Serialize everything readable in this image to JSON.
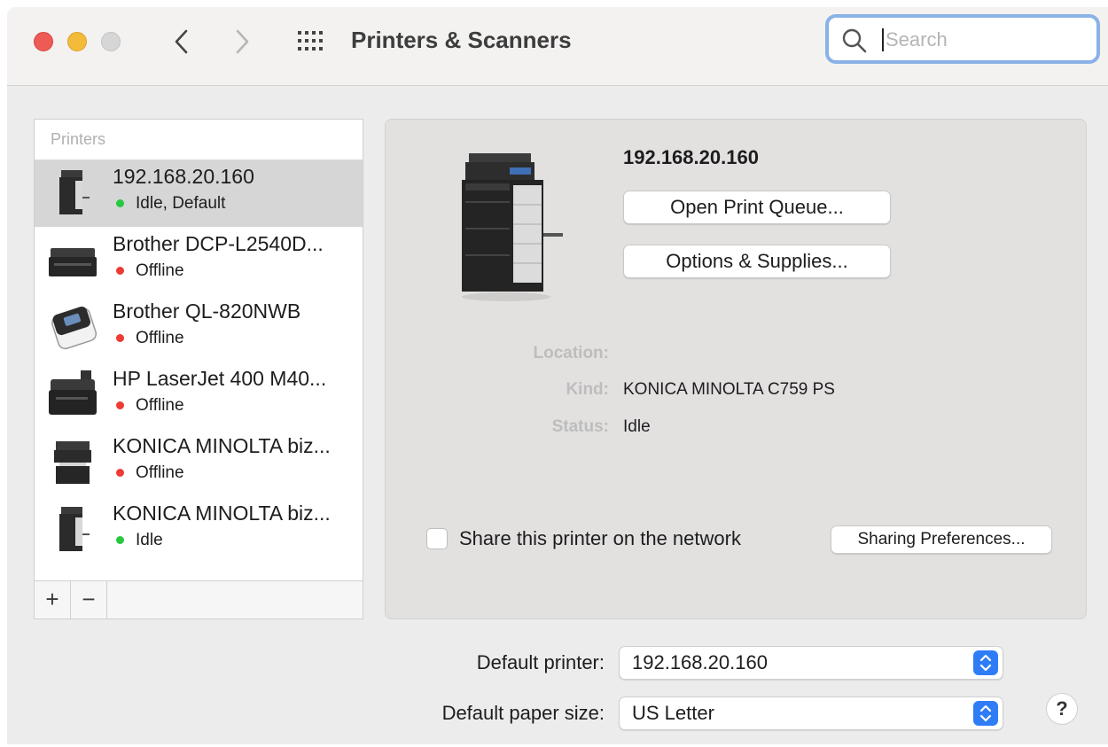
{
  "window": {
    "title": "Printers & Scanners",
    "search": {
      "placeholder": "Search",
      "value": ""
    }
  },
  "printers": {
    "header": "Printers",
    "items": [
      {
        "name": "192.168.20.160",
        "status": "Idle, Default",
        "status_color": "#28c840",
        "selected": true
      },
      {
        "name": "Brother DCP-L2540D...",
        "status": "Offline",
        "status_color": "#ee3b33",
        "selected": false
      },
      {
        "name": "Brother QL-820NWB",
        "status": "Offline",
        "status_color": "#ee3b33",
        "selected": false
      },
      {
        "name": "HP LaserJet 400 M40...",
        "status": "Offline",
        "status_color": "#ee3b33",
        "selected": false
      },
      {
        "name": "KONICA MINOLTA biz...",
        "status": "Offline",
        "status_color": "#ee3b33",
        "selected": false
      },
      {
        "name": "KONICA MINOLTA biz...",
        "status": "Idle",
        "status_color": "#28c840",
        "selected": false
      }
    ],
    "add_label": "+",
    "remove_label": "−"
  },
  "detail": {
    "title": "192.168.20.160",
    "open_queue_label": "Open Print Queue...",
    "options_label": "Options & Supplies...",
    "location_label": "Location:",
    "location_value": "",
    "kind_label": "Kind:",
    "kind_value": "KONICA MINOLTA C759 PS",
    "status_label": "Status:",
    "status_value": "Idle",
    "share_label": "Share this printer on the network",
    "share_checked": false,
    "sharing_prefs_label": "Sharing Preferences..."
  },
  "defaults": {
    "printer_label": "Default printer:",
    "printer_value": "192.168.20.160",
    "paper_label": "Default paper size:",
    "paper_value": "US Letter"
  },
  "help_label": "?",
  "colors": {
    "accent": "#2f7df6",
    "search_focus": "#8ab2e6"
  }
}
